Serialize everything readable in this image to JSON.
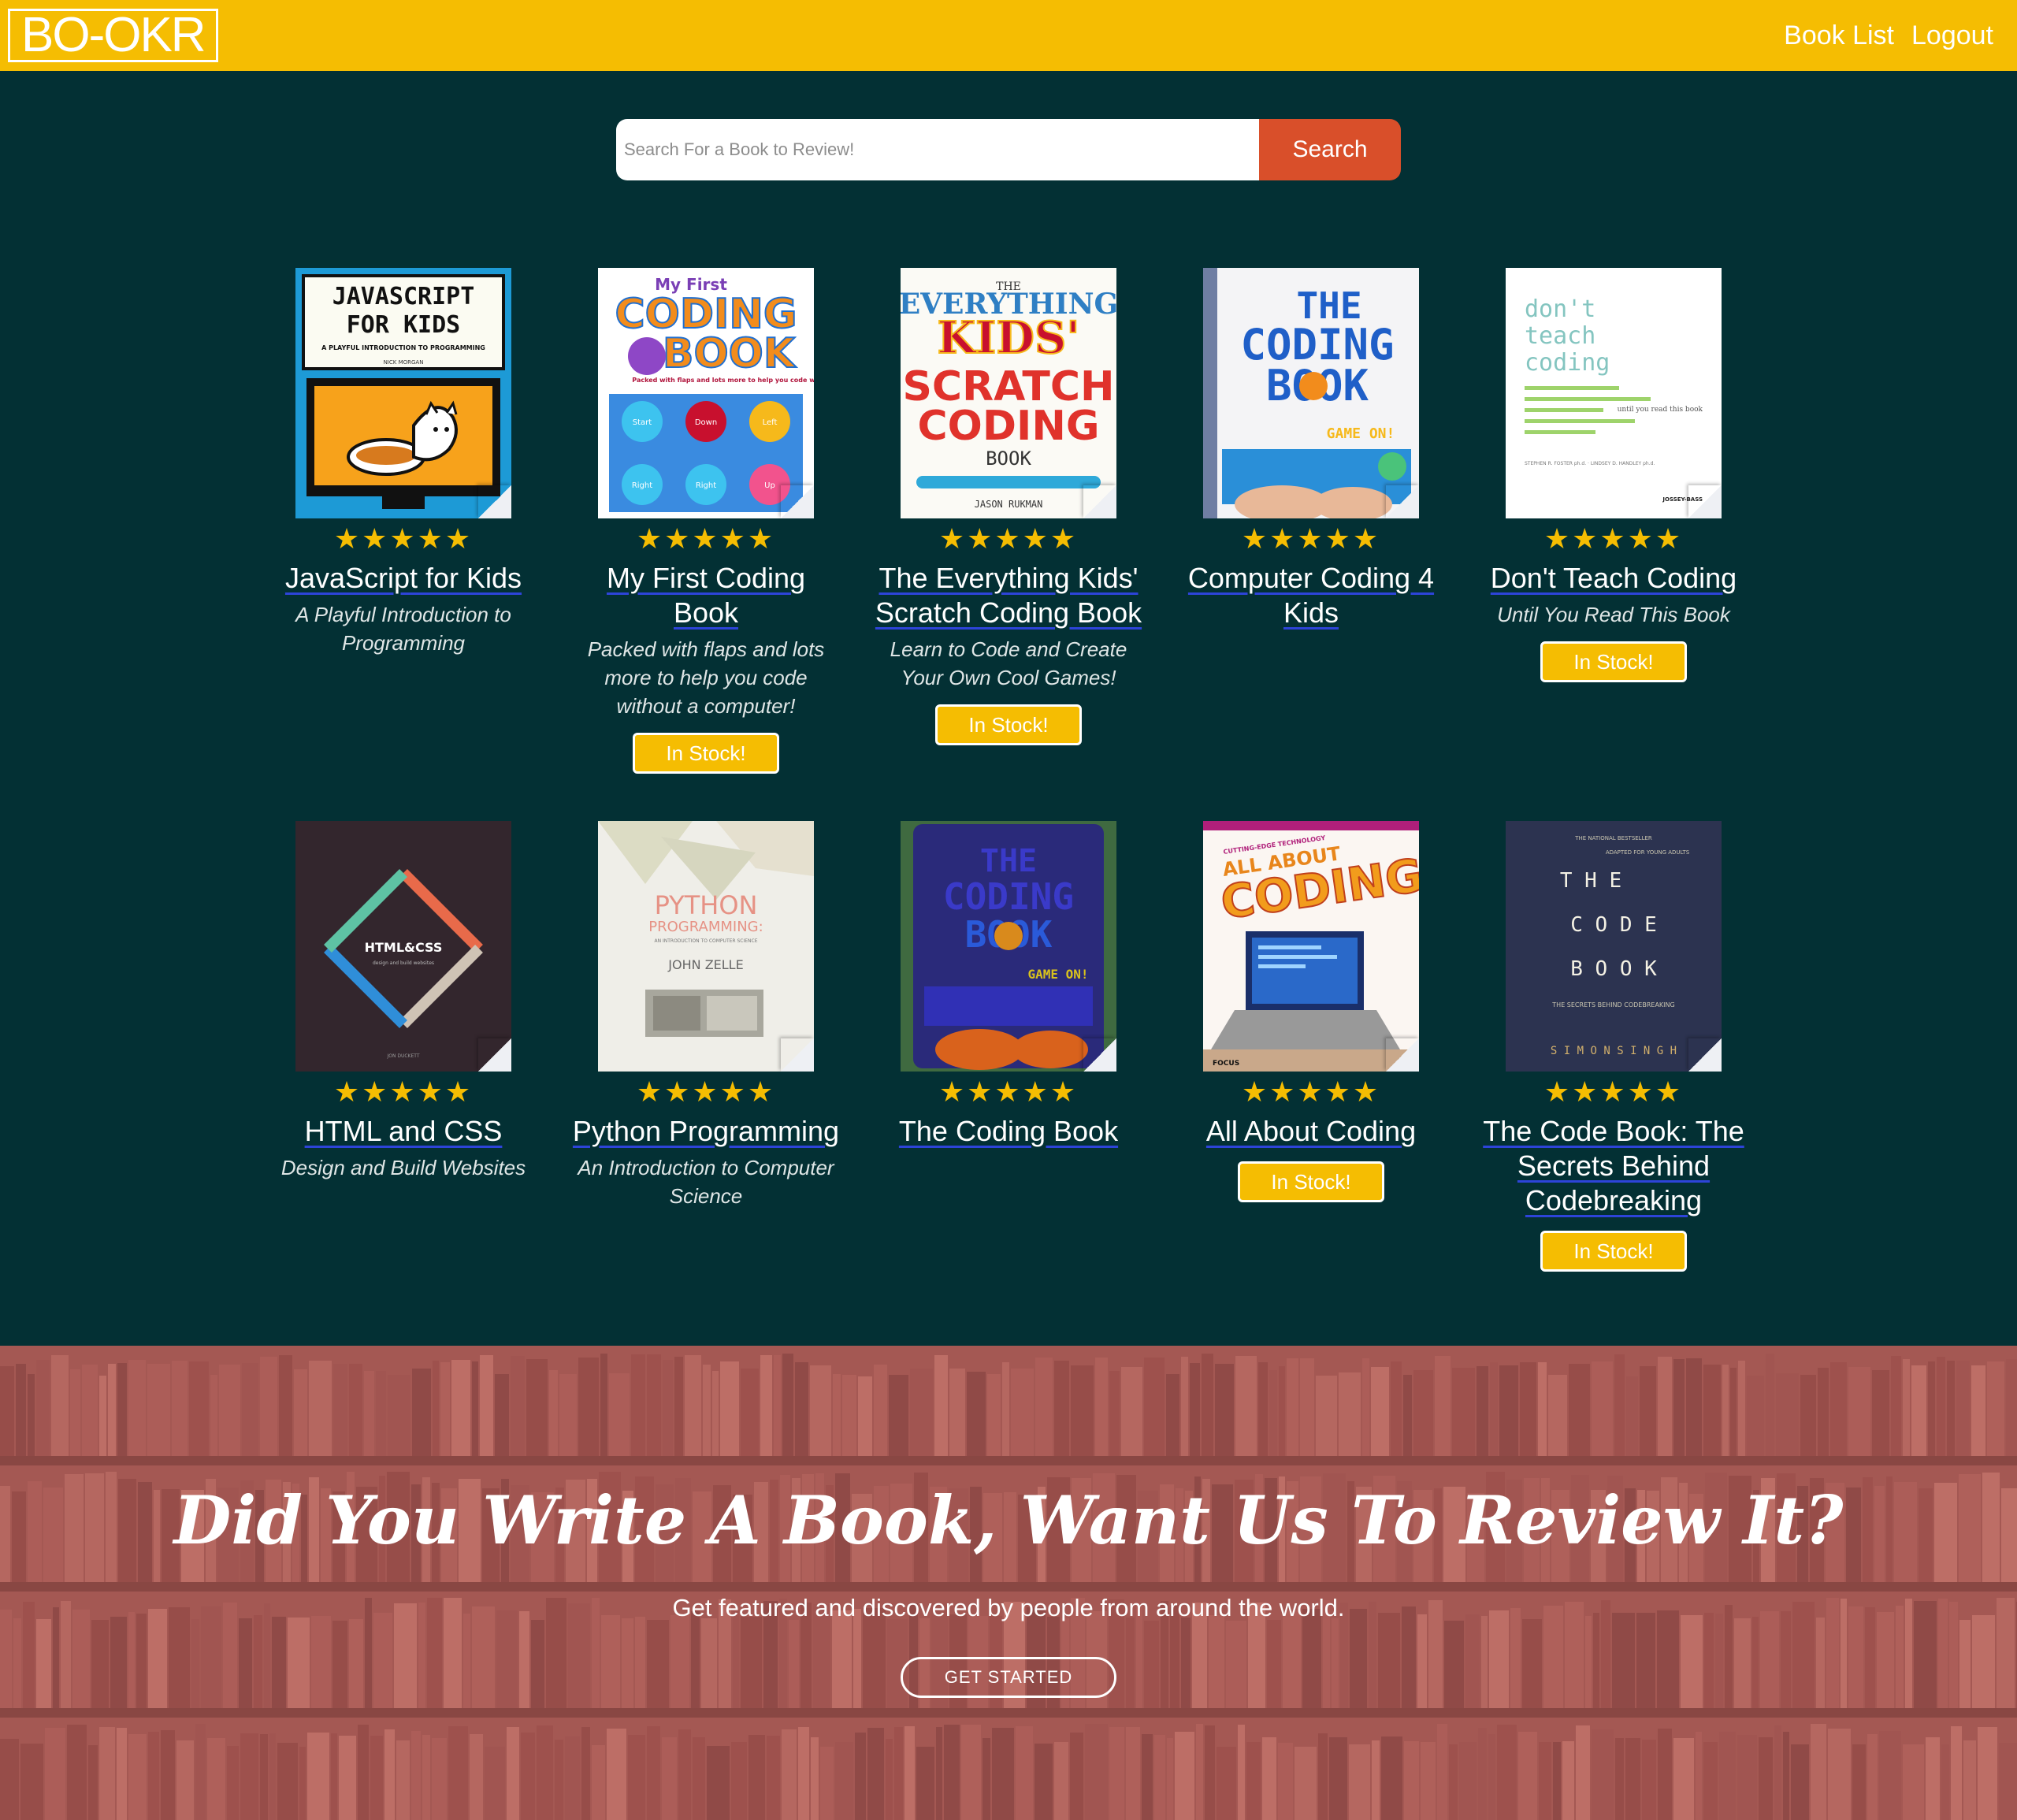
{
  "navbar": {
    "logo": "BO-OKR",
    "links": [
      "Book List",
      "Logout"
    ]
  },
  "search": {
    "placeholder": "Search For a Book to Review!",
    "button_label": "Search"
  },
  "rating_stars": "★★★★★",
  "stock_label": "In Stock!",
  "books": [
    {
      "title": "JavaScript for Kids",
      "subtitle": "A Playful Introduction to Programming",
      "in_stock": false,
      "cover_color": "#1d9ad6"
    },
    {
      "title": "My First Coding Book",
      "subtitle": "Packed with flaps and lots more to help you code without a computer!",
      "in_stock": true,
      "cover_color": "#ffffff"
    },
    {
      "title": "The Everything Kids' Scratch Coding Book",
      "subtitle": "Learn to Code and Create Your Own Cool Games!",
      "in_stock": true,
      "cover_color": "#fbfaf5"
    },
    {
      "title": "Computer Coding 4 Kids",
      "subtitle": "",
      "in_stock": false,
      "cover_color": "#f4f4f6"
    },
    {
      "title": "Don't Teach Coding",
      "subtitle": "Until You Read This Book",
      "in_stock": true,
      "cover_color": "#ffffff"
    },
    {
      "title": "HTML and CSS",
      "subtitle": "Design and Build Websites",
      "in_stock": false,
      "cover_color": "#33262d"
    },
    {
      "title": "Python Programming",
      "subtitle": "An Introduction to Computer Science",
      "in_stock": false,
      "cover_color": "#efeee8"
    },
    {
      "title": "The Coding Book",
      "subtitle": "",
      "in_stock": false,
      "cover_color": "#2a2a7a"
    },
    {
      "title": "All About Coding",
      "subtitle": "",
      "in_stock": true,
      "cover_color": "#fbf6f2"
    },
    {
      "title": "The Code Book: The Secrets Behind Codebreaking",
      "subtitle": "",
      "in_stock": true,
      "cover_color": "#2c3350"
    }
  ],
  "covers": {
    "js_kids": {
      "title_line1": "JAVASCRIPT",
      "title_line2": "FOR KIDS",
      "tagline": "A PLAYFUL INTRODUCTION TO PROGRAMMING",
      "author": "NICK MORGAN"
    },
    "my_first": {
      "small": "My First",
      "big1": "CODING",
      "big2": "BOOK",
      "tagline": "Packed with flaps and lots more to help you code without a computer!",
      "pads": [
        "Start",
        "Down",
        "Left",
        "Right",
        "Right",
        "Up"
      ]
    },
    "everything": {
      "the": "THE",
      "line1": "EVERYTHING",
      "line2": "KIDS'",
      "line3": "SCRATCH",
      "line4": "CODING",
      "line5": "BOOK",
      "author": "JASON RUKMAN"
    },
    "computer_coding": {
      "line1": "THE",
      "line2": "CODING",
      "line3": "BOOK",
      "tagline": "GAME ON!"
    },
    "dont_teach": {
      "line1": "don't",
      "line2": "teach",
      "line3": "coding",
      "tagline": "until you read this book",
      "authors": "STEPHEN R. FOSTER ph.d. · LINDSEY D. HANDLEY ph.d.",
      "publisher": "JOSSEY-BASS"
    },
    "html_css": {
      "title": "HTML&CSS",
      "tagline": "design and build websites",
      "author": "JON DUCKETT"
    },
    "python": {
      "line1": "PYTHON",
      "line2": "PROGRAMMING:",
      "tagline": "AN INTRODUCTION TO COMPUTER SCIENCE",
      "author": "JOHN ZELLE"
    },
    "coding_book_blue": {
      "line1": "THE",
      "line2": "CODING",
      "line3": "BOOK",
      "tagline": "GAME ON!"
    },
    "all_about": {
      "tagline": "CUTTING-EDGE TECHNOLOGY",
      "line1": "ALL ABOUT",
      "line2": "CODING",
      "publisher": "FOCUS"
    },
    "code_book": {
      "top": "THE NATIONAL BESTSELLER",
      "sub": "ADAPTED FOR YOUNG ADULTS",
      "line1": "T H E",
      "line2": "C O D E",
      "line3": "B O O K",
      "tagline": "THE SECRETS BEHIND CODEBREAKING",
      "author": "S I M O N  S I N G H"
    }
  },
  "hero": {
    "title": "Did You Write A Book, Want Us To Review It?",
    "subtitle": "Get featured and discovered by people from around the world.",
    "button_label": "GET STARTED"
  },
  "colors": {
    "navbar": "#f5bd02",
    "page_bg": "#033034",
    "search_button": "#d94f2a",
    "stars": "#f5bd02",
    "link_underline": "#2d44d9",
    "hero_tint": "#b9645f"
  }
}
